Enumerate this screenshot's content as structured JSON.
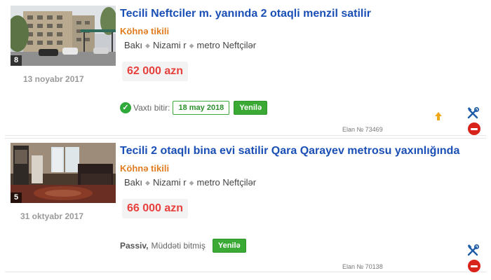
{
  "listings": [
    {
      "title": "Tecili Neftciler m. yanında 2 otaqli menzil satilir",
      "category": "Köhnə tikili",
      "location": {
        "city": "Bakı",
        "district": "Nizami r",
        "metro": "metro Neftçilər"
      },
      "price": "62 000 azn",
      "date": "13 noyabr 2017",
      "photo_count": "8",
      "expiry_label": "Vaxtı bitir:",
      "expiry_date": "18 may 2018",
      "renew_label": "Yenilə",
      "elan_number": "Elan № 73469",
      "icons": [
        "check-icon",
        "bump-up-icon",
        "tools-icon",
        "delete-icon"
      ]
    },
    {
      "title": "Tecili 2 otaqlı bina evi satilir Qara Qarayev metrosu yaxınlığında",
      "category": "Köhnə tikili",
      "location": {
        "city": "Bakı",
        "district": "Nizami r",
        "metro": "metro Neftçilər"
      },
      "price": "66 000 azn",
      "date": "31 oktyabr 2017",
      "photo_count": "5",
      "status_label": "Passiv,",
      "status_text": "Müddəti bitmiş",
      "renew_label": "Yenilə",
      "elan_number": "Elan № 70138",
      "icons": [
        "tools-icon",
        "delete-icon"
      ]
    }
  ],
  "colors": {
    "title": "#1a4fb6",
    "category": "#e07c1f",
    "price": "#e8403d",
    "renew": "#3aaa35",
    "delete": "#d8231b"
  }
}
